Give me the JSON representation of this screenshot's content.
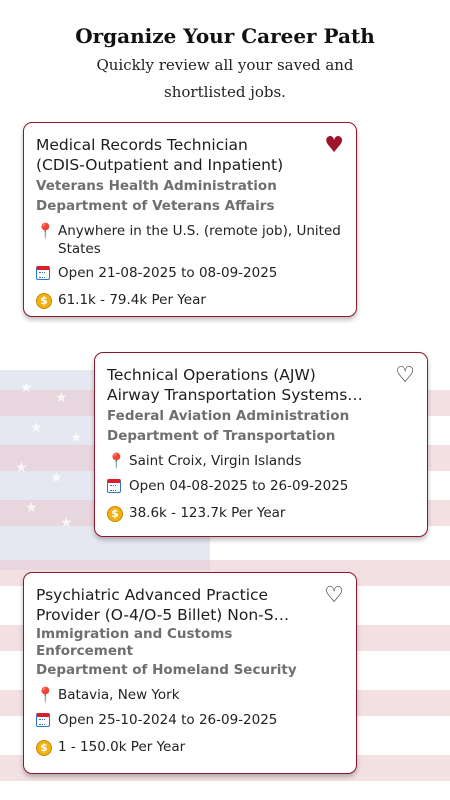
{
  "header": {
    "title": "Organize Your Career Path",
    "subtitle": "Quickly review all your saved and shortlisted jobs."
  },
  "jobs": [
    {
      "title": "Medical Records Technician\n(CDIS-Outpatient and Inpatient)",
      "agency": "Veterans Health Administration",
      "department": "Department of Veterans Affairs",
      "location": "Anywhere in the U.S. (remote job), United States",
      "open": "Open 21-08-2025 to 08-09-2025",
      "salary": "61.1k - 79.4k Per Year",
      "favorite_icon": "heart-filled"
    },
    {
      "title": "Technical Operations (AJW)\nAirway Transportation Systems…",
      "agency": "Federal Aviation Administration",
      "department": "Department of Transportation",
      "location": "Saint Croix, Virgin Islands",
      "open": "Open 04-08-2025 to 26-09-2025",
      "salary": "38.6k - 123.7k Per Year",
      "favorite_icon": "heart-outline"
    },
    {
      "title": "Psychiatric Advanced Practice\nProvider (O-4/O-5 Billet) Non-S…",
      "agency": "Immigration and Customs Enforcement",
      "department": "Department of Homeland Security",
      "location": "Batavia, New York",
      "open": "Open 25-10-2024 to 26-09-2025",
      "salary": "1 - 150.0k Per Year",
      "favorite_icon": "heart-outline"
    }
  ],
  "colors": {
    "accent": "#8b1a2b",
    "heart": "#a0152b"
  }
}
